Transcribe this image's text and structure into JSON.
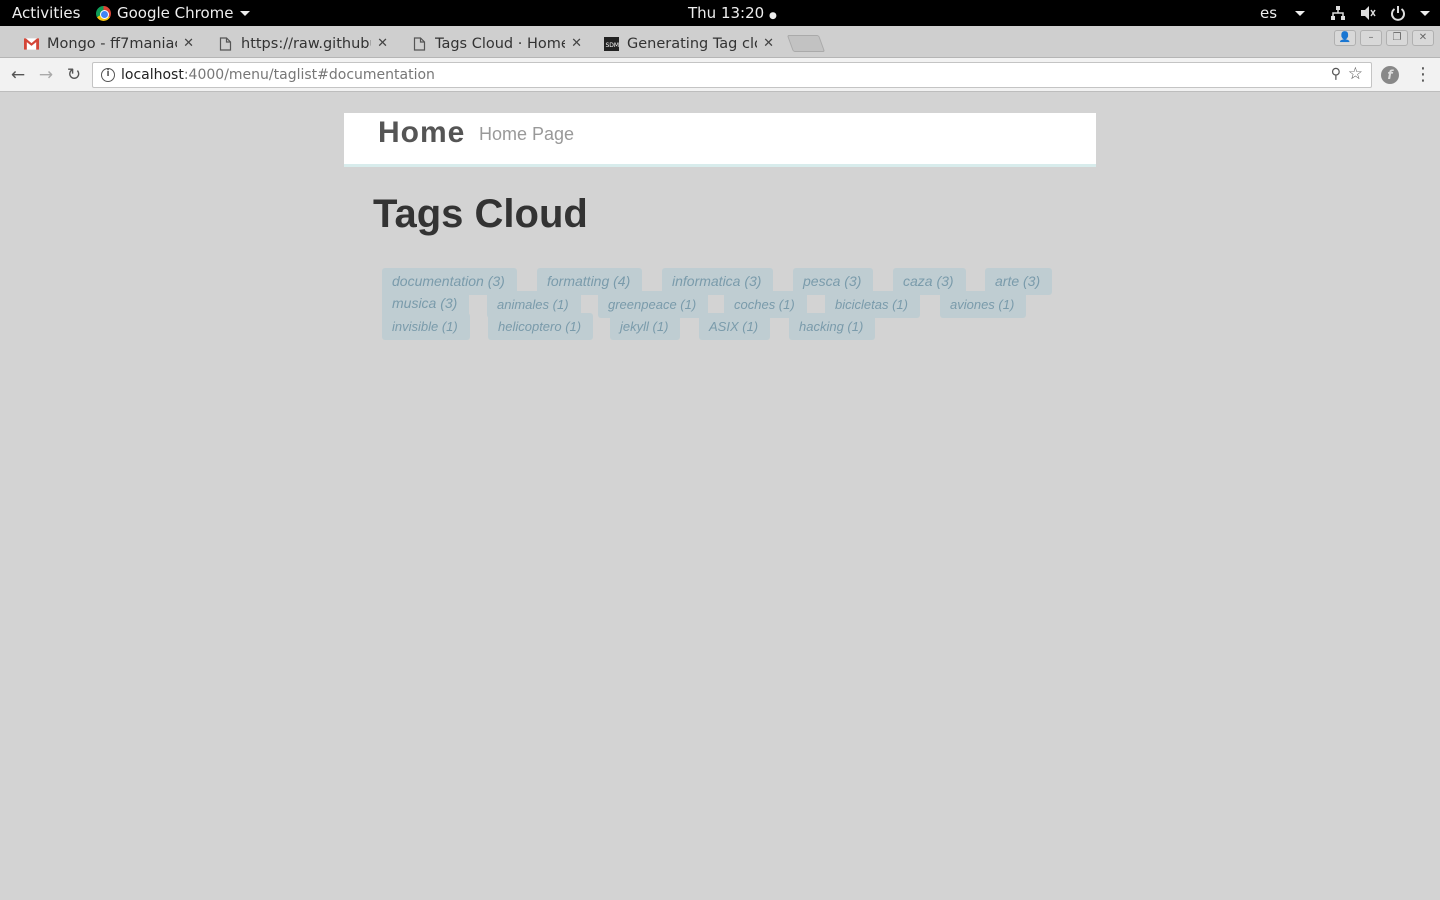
{
  "system_bar": {
    "activities": "Activities",
    "app_name": "Google Chrome",
    "clock": "Thu 13:20",
    "language": "es"
  },
  "tabs": [
    {
      "title": "Mongo - ff7maniac@",
      "icon": "gmail-icon",
      "active": false
    },
    {
      "title": "https://raw.githubus",
      "icon": "page-icon",
      "active": false
    },
    {
      "title": "Tags Cloud · Home",
      "icon": "page-icon",
      "active": true
    },
    {
      "title": "Generating Tag clou",
      "icon": "sdm-icon",
      "active": false
    }
  ],
  "toolbar": {
    "url_host": "localhost",
    "url_rest": ":4000/menu/taglist#documentation"
  },
  "site": {
    "brand": "Home",
    "tagline": "Home Page"
  },
  "page": {
    "title": "Tags Cloud"
  },
  "tags": [
    {
      "label": "documentation (3)"
    },
    {
      "label": "formatting (4)"
    },
    {
      "label": "informatica (3)"
    },
    {
      "label": "pesca (3)"
    },
    {
      "label": "caza (3)"
    },
    {
      "label": "arte (3)"
    },
    {
      "label": "musica (3)"
    },
    {
      "label": "animales (1)"
    },
    {
      "label": "greenpeace (1)"
    },
    {
      "label": "coches (1)"
    },
    {
      "label": "bicicletas (1)"
    },
    {
      "label": "aviones (1)"
    },
    {
      "label": "invisible (1)"
    },
    {
      "label": "helicoptero (1)"
    },
    {
      "label": "jekyll (1)"
    },
    {
      "label": "ASIX (1)"
    },
    {
      "label": "hacking (1)"
    }
  ]
}
